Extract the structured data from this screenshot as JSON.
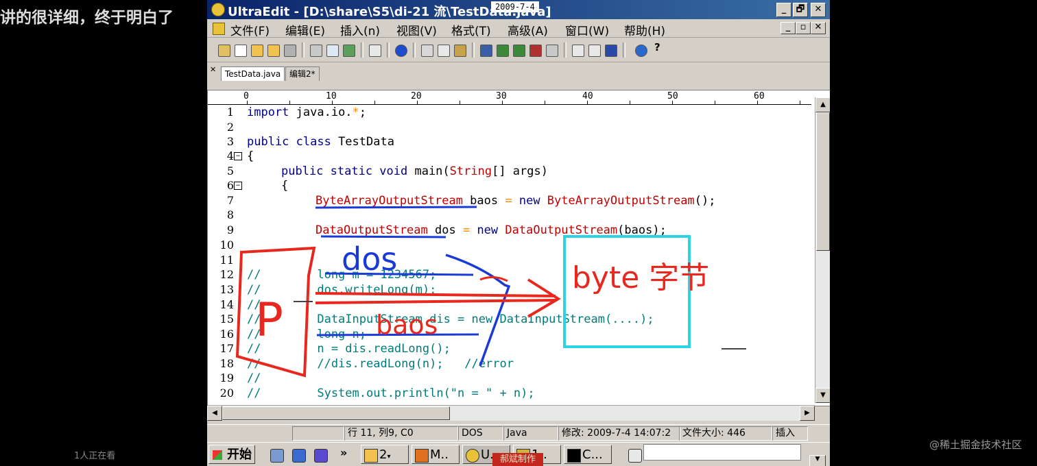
{
  "overlay": {
    "caption": "讲的很详细，终于明白了",
    "date_stamp": "2009-7-4",
    "viewers": "1人正在看",
    "watermark": "@稀土掘金技术社区",
    "bottom_stamp": "郝斌制作"
  },
  "window": {
    "title": "UltraEdit - [D:\\share\\S5\\di-21 流\\TestData.java]",
    "minimize": "_",
    "maximize": "🗗",
    "close": "✕"
  },
  "menu": {
    "items": [
      "文件(F)",
      "编辑(E)",
      "插入(n)",
      "视图(V)",
      "格式(T)",
      "高级(A)",
      "窗口(W)",
      "帮助(H)"
    ]
  },
  "tabs": [
    {
      "label": "TestData.java",
      "active": true
    },
    {
      "label": "编辑2*",
      "active": false
    }
  ],
  "ruler": {
    "labels": [
      "0",
      "10",
      "20",
      "30",
      "40",
      "50",
      "60"
    ]
  },
  "editor": {
    "line_numbers": [
      "1",
      "2",
      "3",
      "4",
      "5",
      "6",
      "7",
      "8",
      "9",
      "10",
      "11",
      "12",
      "13",
      "14",
      "15",
      "16",
      "17",
      "18",
      "19",
      "20"
    ],
    "lines": {
      "l1_kw": "import",
      "l1_rest": " java.io.",
      "l1_star": "*",
      "l1_end": ";",
      "l3_kw": "public class",
      "l3_rest": " TestData",
      "l4": "{",
      "l5_kw": "public static void",
      "l5_a": " main(",
      "l5_red": "String",
      "l5_b": "[] args)",
      "l6": "{",
      "l7_red1": "ByteArrayOutputStream",
      "l7_a": " baos ",
      "l7_eq": "=",
      "l7_kw": " new ",
      "l7_red2": "ByteArrayOutputStream",
      "l7_b": "();",
      "l9_red1": "DataOutputStream",
      "l9_a": " dos ",
      "l9_eq": "=",
      "l9_kw": " new ",
      "l9_red2": "DataOutputStream",
      "l9_b": "(baos);",
      "l12": "//        long m = 1234567;",
      "l13": "//        dos.writeLong(m);",
      "l14": "//",
      "l15": "//        DataInputStream dis = new DataInputStream(....);",
      "l16": "//        long n;",
      "l17": "//        n = dis.readLong();",
      "l18": "//        //dis.readLong(n);   //error",
      "l19": "//",
      "l20": "//        System.out.println(\"n = \" + n);"
    }
  },
  "status": {
    "position": "行 11, 列9, C0",
    "line_ending": "DOS",
    "language": "Java",
    "modified": "修改: 2009-7-4 14:07:2",
    "file_size": "文件大小: 446",
    "mode": "插入"
  },
  "taskbar": {
    "start": "开始",
    "tasks": [
      "2",
      "M..",
      "U..",
      "1..",
      "C..."
    ]
  },
  "annotations": {
    "dos": "dos",
    "baos": "baos",
    "p": "P",
    "byte_array": "byte 字节"
  },
  "colors": {
    "ink_red": "#e8281e",
    "ink_blue": "#1a3ad6",
    "box_cyan": "#2ad3e6"
  }
}
